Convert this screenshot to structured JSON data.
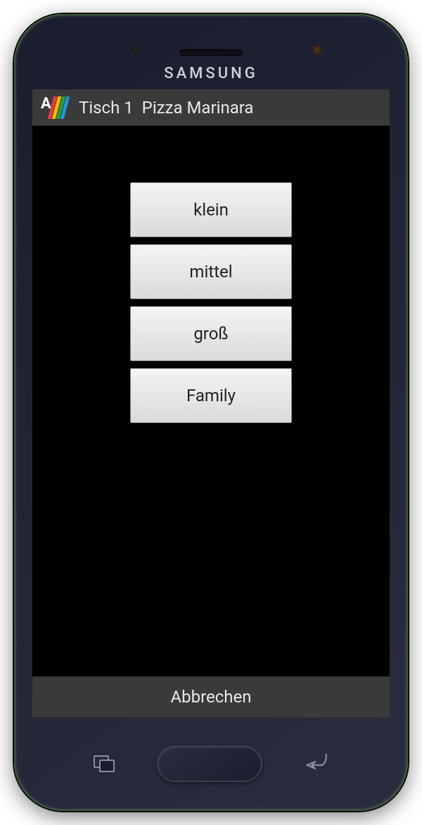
{
  "device": {
    "brand": "SAMSUNG"
  },
  "header": {
    "table_label": "Tisch 1",
    "item_label": "Pizza Marinara"
  },
  "sizes": [
    {
      "label": "klein"
    },
    {
      "label": "mittel"
    },
    {
      "label": "groß"
    },
    {
      "label": "Family"
    }
  ],
  "footer": {
    "cancel_label": "Abbrechen"
  }
}
